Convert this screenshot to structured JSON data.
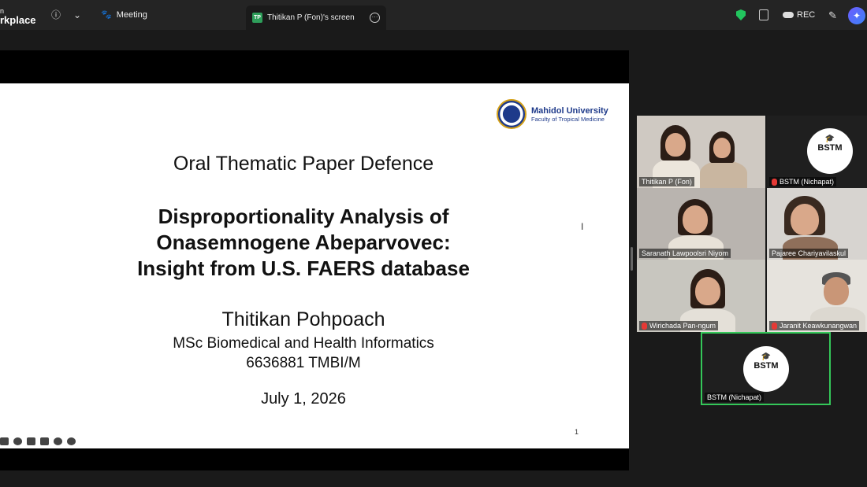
{
  "topbar": {
    "brand_line1": "n",
    "brand_line2": "rkplace",
    "info_icon": "info-icon",
    "meeting_label": "Meeting",
    "share_tab": {
      "badge": "TP",
      "label": "Thitikan P (Fon)'s screen"
    },
    "rec_label": "REC"
  },
  "slide": {
    "logo_university": "Mahidol University",
    "logo_faculty": "Faculty of Tropical Medicine",
    "subtitle": "Oral Thematic Paper Defence",
    "title_line1": "Disproportionality Analysis of",
    "title_line2": "Onasemnogene Abeparvovec:",
    "title_line3": "Insight from U.S. FAERS database",
    "presenter": "Thitikan Pohpoach",
    "program": "MSc Biomedical and Health Informatics",
    "student_id": "6636881 TMBI/M",
    "date": "July 1, 2026",
    "page_number": "1",
    "cursor": "I"
  },
  "participants": [
    {
      "name": "Thitikan P (Fon)",
      "muted": false
    },
    {
      "name": "BSTM (Nichapat)",
      "muted": true
    },
    {
      "name": "Saranath Lawpoolsri Niyom",
      "muted": false
    },
    {
      "name": "Pajaree Chariyavilaskul",
      "muted": false
    },
    {
      "name": "Wirichada Pan-ngum",
      "muted": true
    },
    {
      "name": "Jaranit Keawkunangwan",
      "muted": true
    }
  ],
  "active_speaker": {
    "name": "BSTM (Nichapat)"
  },
  "bstm_logo": {
    "text": "BSTM"
  }
}
